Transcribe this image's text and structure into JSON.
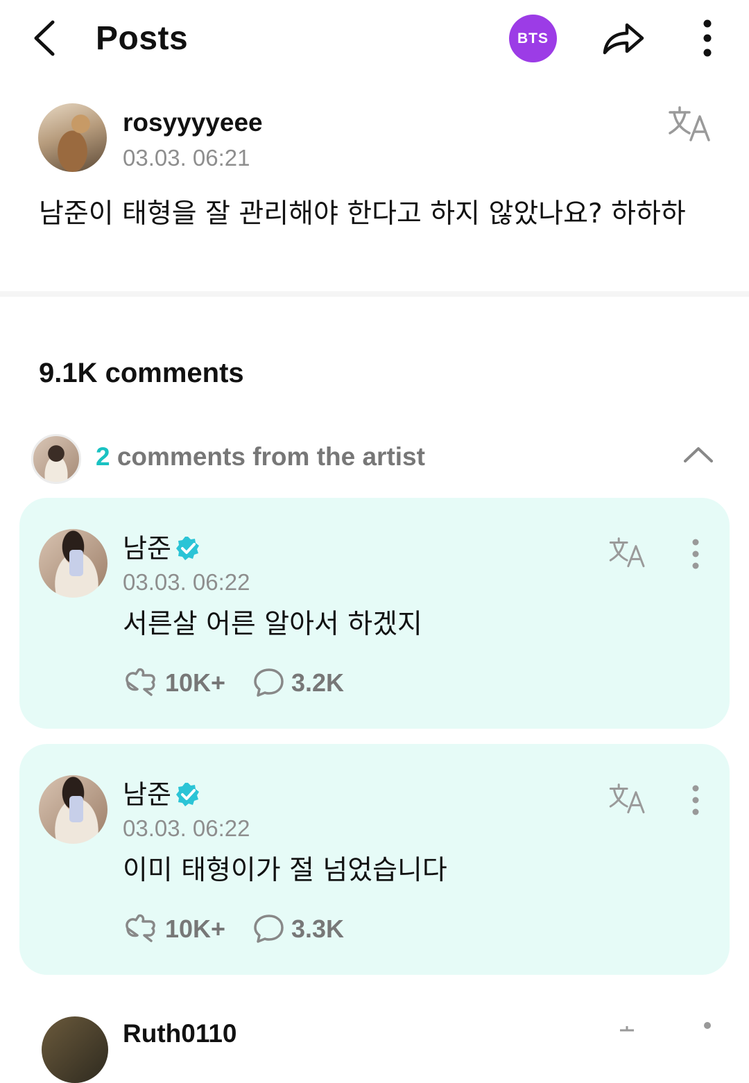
{
  "header": {
    "title": "Posts",
    "community_badge": "BTS",
    "colors": {
      "badge": "#9c3ce6"
    }
  },
  "post": {
    "author": "rosyyyyeee",
    "timestamp": "03.03. 06:21",
    "body": "남준이 태형을 잘 관리해야 한다고 하지 않았나요? 하하하",
    "icons": {
      "translate": "translate-icon",
      "back": "chevron-left-icon",
      "share": "share-icon",
      "more": "more-vertical-icon"
    }
  },
  "comments": {
    "count_label": "9.1K comments",
    "artist_summary": {
      "count": "2",
      "label": " comments from the artist"
    },
    "accent_color": "#19c2c2",
    "card_color": "#e6fbf7",
    "artist_comments": [
      {
        "name": "남준",
        "timestamp": "03.03. 06:22",
        "text": "서른살 어른 알아서 하겠지",
        "likes": "10K+",
        "replies": "3.2K"
      },
      {
        "name": "남준",
        "timestamp": "03.03. 06:22",
        "text": "이미 태형이가 절 넘었습니다",
        "likes": "10K+",
        "replies": "3.3K"
      }
    ],
    "next_comment": {
      "name": "Ruth0110"
    }
  }
}
